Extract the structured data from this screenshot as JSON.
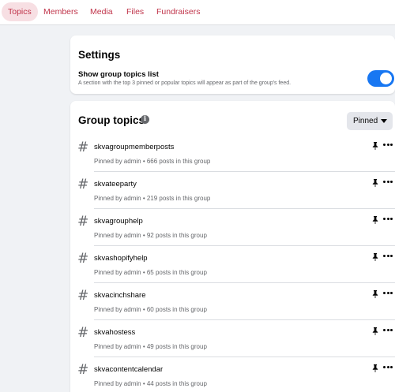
{
  "tabs": {
    "topics": "Topics",
    "members": "Members",
    "media": "Media",
    "files": "Files",
    "fundraisers": "Fundraisers"
  },
  "active_tab": "Topics",
  "settings": {
    "title": "Settings",
    "toggle_label": "Show group topics list",
    "toggle_description": "A section with the top 3 pinned or popular topics will appear as part of the group's feed.",
    "toggle_on": true
  },
  "group_topics": {
    "title": "Group topics",
    "info_icon": "info-icon",
    "sort_value": "Pinned",
    "topics": [
      {
        "name": "skvagroupmemberposts",
        "meta": "Pinned by admin • 666 posts in this group"
      },
      {
        "name": "skvateeparty",
        "meta": "Pinned by admin • 219 posts in this group"
      },
      {
        "name": "skvagrouphelp",
        "meta": "Pinned by admin • 92 posts in this group"
      },
      {
        "name": "skvashopifyhelp",
        "meta": "Pinned by admin • 65 posts in this group"
      },
      {
        "name": "skvacinchshare",
        "meta": "Pinned by admin • 60 posts in this group"
      },
      {
        "name": "skvahostess",
        "meta": "Pinned by admin • 49 posts in this group"
      },
      {
        "name": "skvacontentcalendar",
        "meta": "Pinned by admin • 44 posts in this group"
      }
    ]
  },
  "colors": {
    "accent": "#1877f2",
    "tab_text": "#c0354b",
    "tab_active_bg": "#f7dfe3"
  }
}
